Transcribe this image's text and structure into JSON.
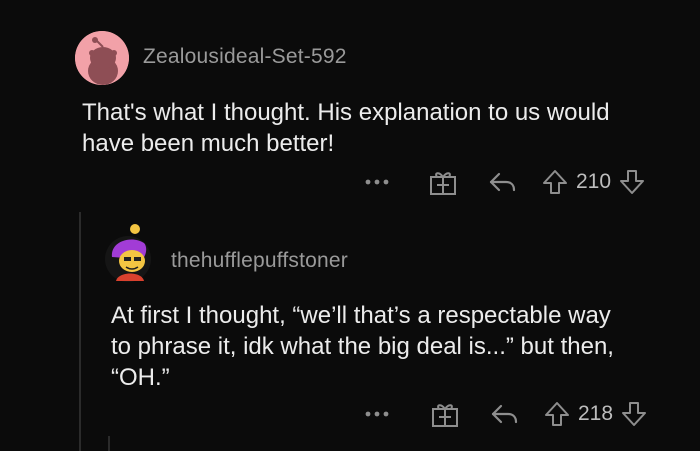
{
  "comments": [
    {
      "username": "Zealousideal-Set-592",
      "body_lines": [
        "That's what I thought. His explanation to us would",
        "have been much better!"
      ],
      "votes": "210",
      "avatar_colors": {
        "bg": "#f2a1a8",
        "figure": "#8e4e55"
      }
    },
    {
      "username": "thehufflepuffstoner",
      "body_lines": [
        "At first I thought, “we’ll that’s a respectable way",
        "to phrase it, idk what the big deal is...” but then,",
        "“OH.”"
      ],
      "votes": "218",
      "avatar_colors": {
        "hair": "#a23cd6",
        "face": "#f4c542",
        "shirt": "#d9412e"
      }
    }
  ],
  "icons": {
    "more": "more-options-icon",
    "award": "award-icon",
    "reply": "reply-icon",
    "upvote": "upvote-icon",
    "downvote": "downvote-icon"
  },
  "colors": {
    "background": "#0b0b0b",
    "text": "#ececec",
    "muted": "#9a9a9a",
    "icon": "#8e8e8e"
  }
}
